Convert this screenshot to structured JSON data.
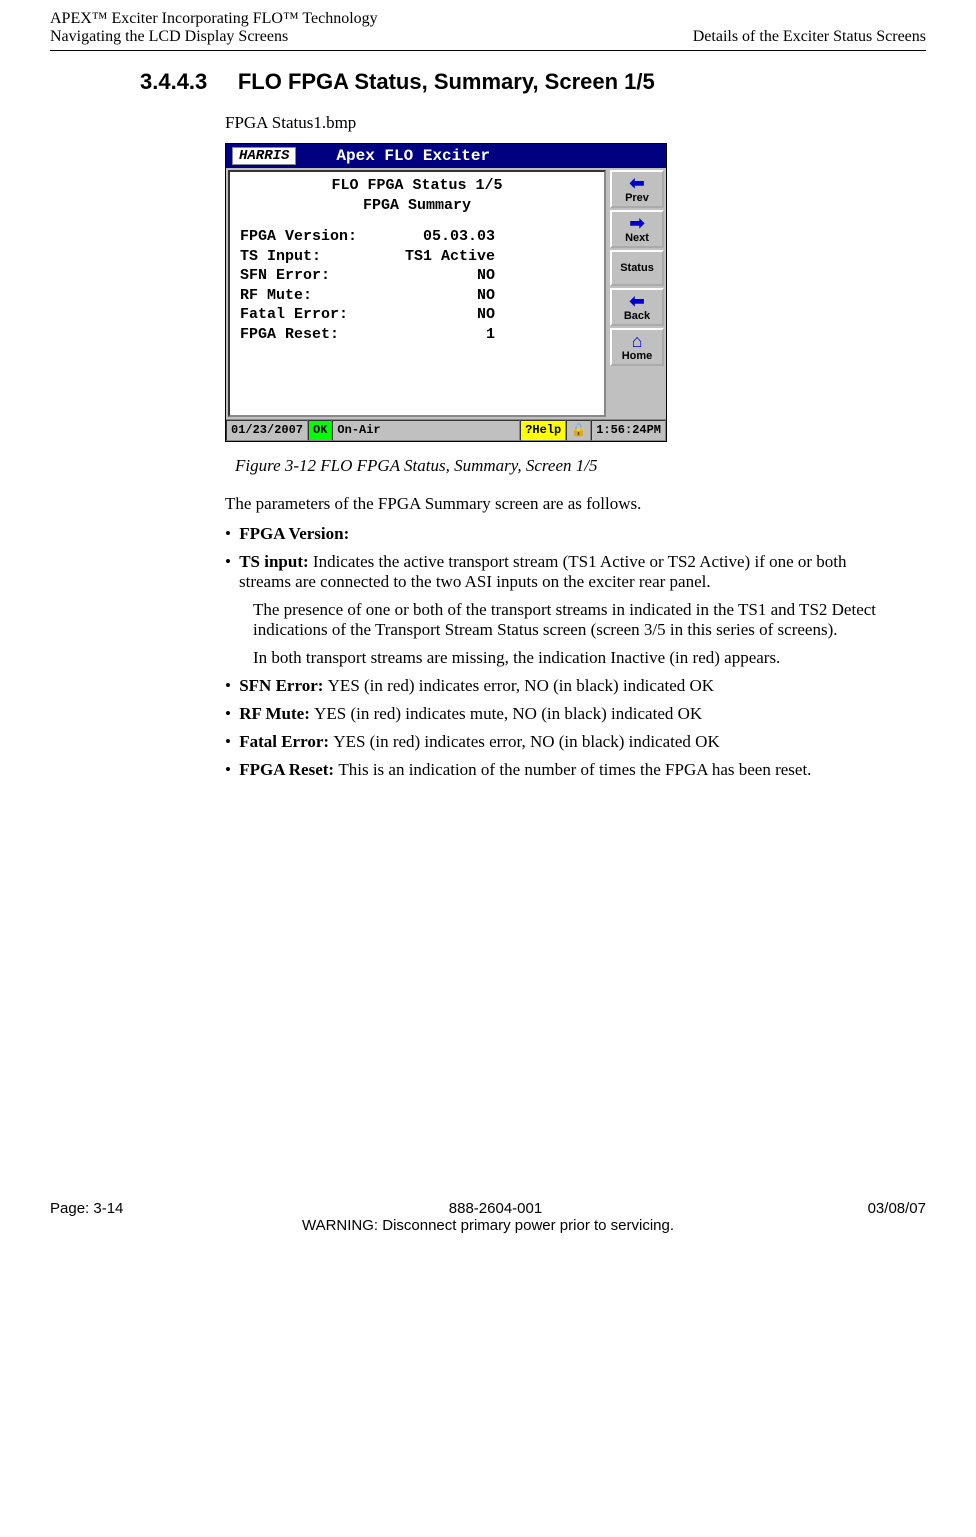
{
  "header": {
    "line1_left": "APEX™ Exciter Incorporating FLO™ Technology",
    "line2_left": "Navigating the LCD Display Screens",
    "line2_right": "Details of the Exciter Status Screens"
  },
  "section": {
    "number": "3.4.4.3",
    "title": "FLO FPGA Status, Summary, Screen 1/5"
  },
  "bmp_label": "FPGA Status1.bmp",
  "lcd": {
    "logo": "HARRIS",
    "titlebar": "Apex FLO Exciter",
    "screen_title1": "FLO FPGA Status 1/5",
    "screen_title2": "FPGA Summary",
    "rows": [
      {
        "label": "FPGA Version:",
        "value": "05.03.03"
      },
      {
        "label": "TS Input:",
        "value": "TS1 Active"
      },
      {
        "label": "SFN Error:",
        "value": "NO"
      },
      {
        "label": "RF Mute:",
        "value": "NO"
      },
      {
        "label": "Fatal Error:",
        "value": "NO"
      },
      {
        "label": "FPGA Reset:",
        "value": "1"
      }
    ],
    "buttons": {
      "prev": "Prev",
      "next": "Next",
      "status": "Status",
      "back": "Back",
      "home": "Home"
    },
    "statusbar": {
      "date": "01/23/2007",
      "ok": "OK",
      "onair": "On-Air",
      "help": "?Help",
      "lock": "🔓",
      "time": "1:56:24PM"
    }
  },
  "figure_caption": "Figure 3-12  FLO FPGA Status, Summary, Screen 1/5",
  "intro_text": "The parameters of the FPGA Summary screen are as follows.",
  "bullets": {
    "fpga_version_label": "FPGA Version:",
    "ts_input_label": "TS input: ",
    "ts_input_text": "Indicates the active transport stream (TS1 Active or TS2 Active) if one or both streams are connected to the two ASI inputs on the exciter rear panel.",
    "ts_input_sub1": "The presence of one or both of the transport streams in indicated in the TS1 and TS2 Detect indications of the Transport Stream Status screen (screen 3/5 in this series of screens).",
    "ts_input_sub2": "In both transport streams are missing, the indication Inactive (in red) appears.",
    "sfn_label": "SFN Error: ",
    "sfn_text": "YES (in red) indicates error, NO (in black) indicated OK",
    "rf_label": "RF Mute: ",
    "rf_text": "YES (in red) indicates mute, NO (in black) indicated OK",
    "fatal_label": "Fatal Error: ",
    "fatal_text": "YES (in red) indicates error, NO (in black) indicated OK",
    "reset_label": "FPGA Reset: ",
    "reset_text": "This is an indication of the number of times the FPGA has been reset."
  },
  "footer": {
    "page": "Page: 3-14",
    "docnum": "888-2604-001",
    "date": "03/08/07",
    "warning": "WARNING: Disconnect primary power prior to servicing."
  }
}
